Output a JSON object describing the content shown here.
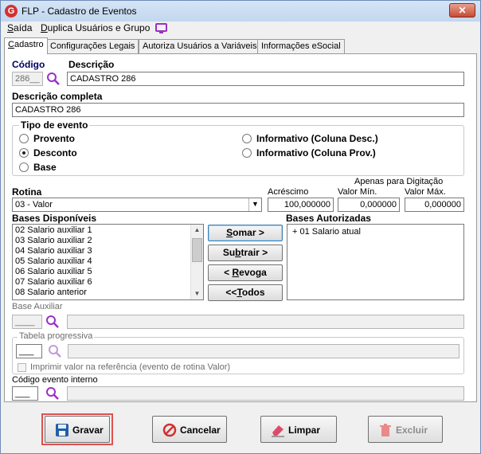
{
  "window": {
    "title": "FLP - Cadastro de Eventos",
    "close_label": "✕",
    "app_icon_letter": "G"
  },
  "menu": [
    {
      "label": "Saída",
      "accel": "S"
    },
    {
      "label": "Duplica Usuários e Grupo",
      "accel": "D"
    }
  ],
  "tabs": [
    {
      "label": "Cadastro",
      "active": true
    },
    {
      "label": "Configurações Legais",
      "active": false
    },
    {
      "label": "Autoriza Usuários a Variáveis",
      "active": false
    },
    {
      "label": "Informações eSocial",
      "active": false
    }
  ],
  "form": {
    "codigo_label": "Código",
    "codigo_value": "286__",
    "descricao_label": "Descrição",
    "descricao_value": "CADASTRO 286",
    "descricao_completa_label": "Descrição completa",
    "descricao_completa_value": "CADASTRO 286",
    "tipo_evento": {
      "label": "Tipo de evento",
      "options": [
        {
          "label": "Provento",
          "checked": false
        },
        {
          "label": "Desconto",
          "checked": true
        },
        {
          "label": "Base",
          "checked": false
        },
        {
          "label": "Informativo (Coluna Desc.)",
          "checked": false
        },
        {
          "label": "Informativo (Coluna Prov.)",
          "checked": false
        }
      ]
    },
    "rotina_label": "Rotina",
    "rotina_value": "03 - Valor",
    "acrescimo_label": "Acréscimo",
    "acrescimo_value": "100,000000",
    "apenas_label": "Apenas para Digitação",
    "valor_min_label": "Valor Mín.",
    "valor_min_value": "0,000000",
    "valor_max_label": "Valor Máx.",
    "valor_max_value": "0,000000",
    "bases_disponiveis_label": "Bases Disponíveis",
    "bases_disponiveis": [
      "02 Salario auxiliar 1",
      "03 Salario auxiliar 2",
      "04 Salario auxiliar 3",
      "05 Salario auxiliar 4",
      "06 Salario auxiliar 5",
      "07 Salario auxiliar 6",
      "08 Salario anterior"
    ],
    "bases_autorizadas_label": "Bases Autorizadas",
    "bases_autorizadas": [
      "+ 01 Salario atual"
    ],
    "somar_label": "Somar >",
    "subtrair_label": "Subtrair >",
    "revoga_label": "< Revoga",
    "todos_label": "<<Todos",
    "base_auxiliar_label": "Base Auxiliar",
    "base_auxiliar_value": "____",
    "tabela_progressiva_label": "Tabela progressiva",
    "tabela_progressiva_value": "___",
    "imprimir_label": "Imprimir valor na referência (evento de rotina Valor)",
    "codigo_interno_label": "Código evento interno",
    "codigo_interno_value": "___"
  },
  "actions": {
    "gravar": "Gravar",
    "cancelar": "Cancelar",
    "limpar": "Limpar",
    "excluir": "Excluir"
  },
  "colors": {
    "accent_purple": "#9b2fc8",
    "danger_red": "#d32f2f",
    "save_blue": "#1f5fa8"
  }
}
